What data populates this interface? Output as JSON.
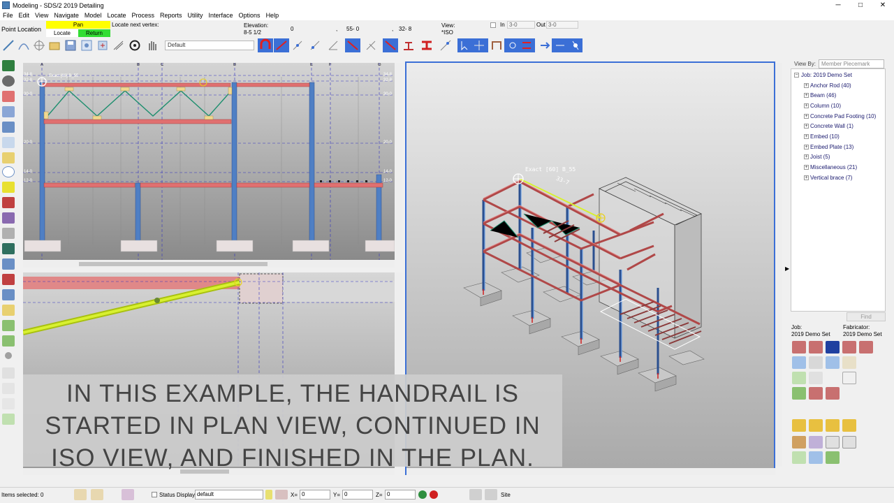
{
  "window": {
    "title": "Modeling - SDS/2 2019 Detailing",
    "min": "─",
    "max": "□",
    "close": "✕"
  },
  "menu": [
    "File",
    "Edit",
    "View",
    "Navigate",
    "Model",
    "Locate",
    "Process",
    "Reports",
    "Utility",
    "Interface",
    "Options",
    "Help"
  ],
  "locate": {
    "mode": "Point Location",
    "pan": "Pan",
    "locate": "Locate",
    "return": "Return",
    "prompt": "Locate next vertex:",
    "elevation_label": "Elevation:",
    "elevation_value": "8-5 1/2",
    "x": "0",
    "y": "55- 0",
    "z": "32- 8",
    "comma1": ",",
    "comma2": ",",
    "view_label": "View:",
    "view_value": "*ISO",
    "in_label": "In",
    "in_value": "3-0",
    "out_label": "Out",
    "out_value": "3-0"
  },
  "toolbar": {
    "combo_default": "Default"
  },
  "elevation_view": {
    "grid_letters": [
      "A",
      "B",
      "C",
      "B",
      "E",
      "F",
      "G"
    ],
    "left_levels": [
      "34-8",
      "32-8",
      "30-0",
      "20-0",
      "14-0",
      "12-0"
    ],
    "right_levels": [
      "34-8",
      "32-8",
      "30-0",
      "20-0",
      "14-0",
      "12-0"
    ],
    "snap_label": "Exact [60] B_55"
  },
  "iso_view": {
    "snap_label": "Exact [60] B_55",
    "dimension": "33-7"
  },
  "tree": {
    "view_by_label": "View By:",
    "view_by_value": "Member Piecemark",
    "root": "Job: 2019 Demo Set",
    "items": [
      "Anchor Rod (40)",
      "Beam (46)",
      "Column (10)",
      "Concrete Pad Footing (10)",
      "Concrete Wall (1)",
      "Embed (10)",
      "Embed Plate (13)",
      "Joist (5)",
      "Miscellaneous (21)",
      "Vertical brace (7)"
    ],
    "find": "Find"
  },
  "job_panel": {
    "job_label": "Job:",
    "job_value": "2019 Demo Set",
    "fab_label": "Fabricator:",
    "fab_value": "2019 Demo Set"
  },
  "caption": [
    "IN THIS EXAMPLE, THE HANDRAIL IS",
    "STARTED IN PLAN VIEW, CONTINUED IN",
    "ISO VIEW, AND FINISHED IN THE PLAN."
  ],
  "status": {
    "items_selected": "Items selected: 0",
    "status_display": "Status Display",
    "display_value": "default",
    "x_label": "X=",
    "x_value": "0",
    "y_label": "Y=",
    "y_value": "0",
    "z_label": "Z=",
    "z_value": "0",
    "site": "Site"
  },
  "colors": {
    "pan_bg": "#ffff00",
    "return_bg": "#33dd33",
    "beam": "#e07070",
    "column": "#4f7fc4",
    "handrail": "#c8e61e",
    "joist": "#1f8f6f",
    "iso_border": "#3b6fd6"
  }
}
